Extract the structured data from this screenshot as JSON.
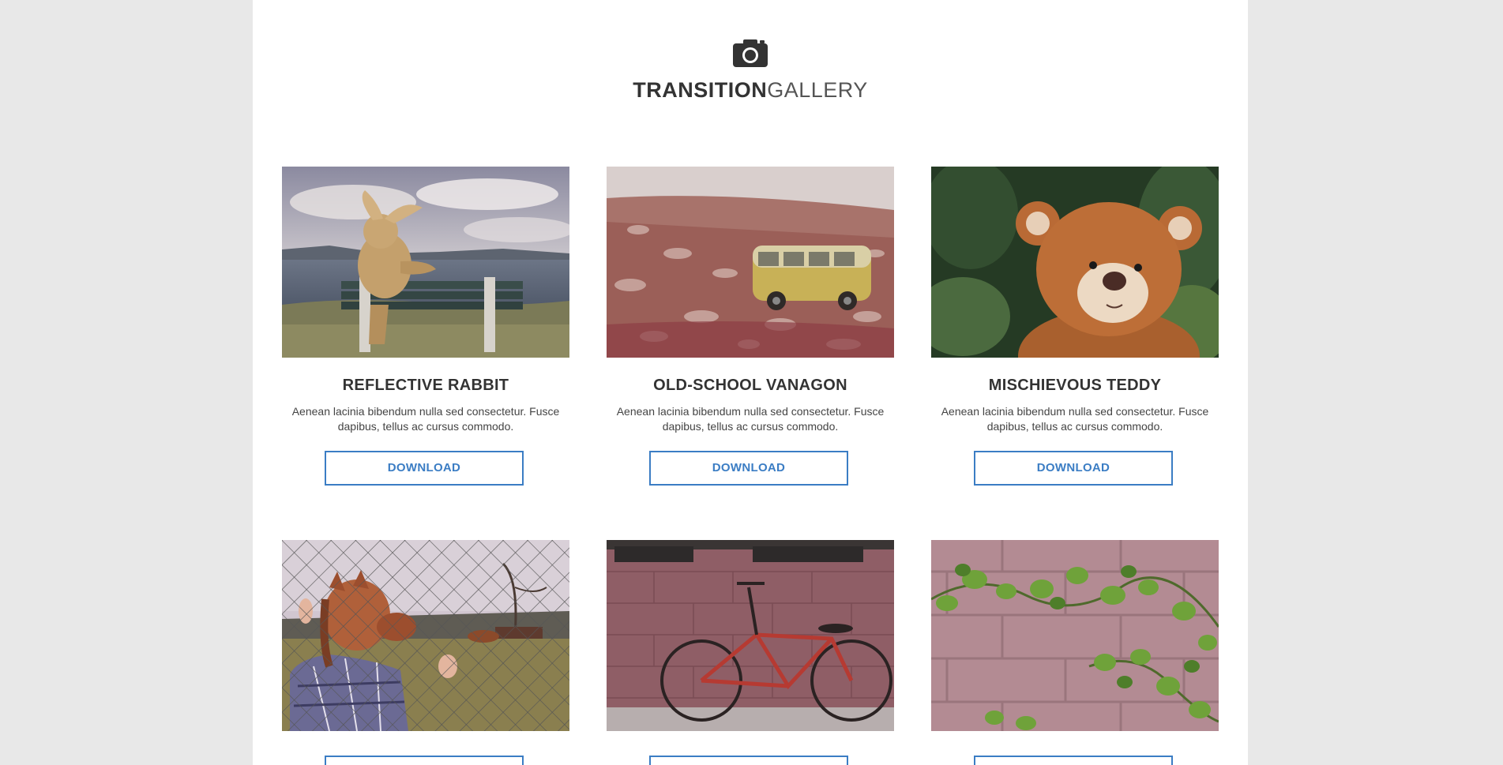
{
  "brand": {
    "strong": "TRANSITION",
    "light": "GALLERY",
    "icon": "camera-icon"
  },
  "cards": [
    {
      "title": "REFLECTIVE RABBIT",
      "text": "Aenean lacinia bibendum nulla sed consectetur. Fusce dapibus, tellus ac cursus commodo.",
      "button": "DOWNLOAD"
    },
    {
      "title": "OLD-SCHOOL VANAGON",
      "text": "Aenean lacinia bibendum nulla sed consectetur. Fusce dapibus, tellus ac cursus commodo.",
      "button": "DOWNLOAD"
    },
    {
      "title": "MISCHIEVOUS TEDDY",
      "text": "Aenean lacinia bibendum nulla sed consectetur. Fusce dapibus, tellus ac cursus commodo.",
      "button": "DOWNLOAD"
    },
    {
      "title": "",
      "text": "",
      "button": ""
    },
    {
      "title": "",
      "text": "",
      "button": ""
    },
    {
      "title": "",
      "text": "",
      "button": ""
    }
  ],
  "colors": {
    "accent": "#3b7dc4",
    "page_bg": "#e8e8e8",
    "content_bg": "#ffffff",
    "text": "#333333"
  }
}
